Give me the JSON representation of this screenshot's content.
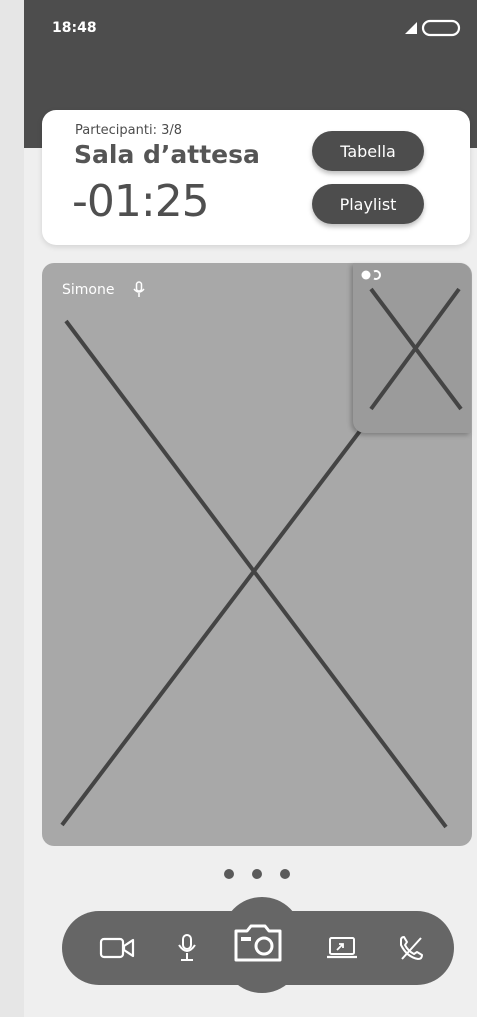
{
  "status_bar": {
    "time": "18:48",
    "icons": [
      "signal-icon",
      "battery-icon"
    ]
  },
  "info_card": {
    "participants": "Partecipanti: 3/8",
    "title": "Sala d’attesa",
    "countdown": "-01:25",
    "buttons": {
      "tabella": "Tabella",
      "playlist": "Playlist"
    }
  },
  "main_video": {
    "speaker_name": "Simone",
    "speaker_icon": "microphone-icon"
  },
  "pip_video": {
    "toggle_icon": "camera-switch-icon"
  },
  "pagination": {
    "dots": 3
  },
  "controls": {
    "items": [
      "video-camera-icon",
      "microphone-icon",
      "camera-icon",
      "screen-share-icon",
      "end-call-icon"
    ]
  },
  "colors": {
    "header": "#4d4d4d",
    "background": "#efefef",
    "card": "#ffffff",
    "video_placeholder": "#a8a8a8",
    "control_bar": "#666666"
  }
}
